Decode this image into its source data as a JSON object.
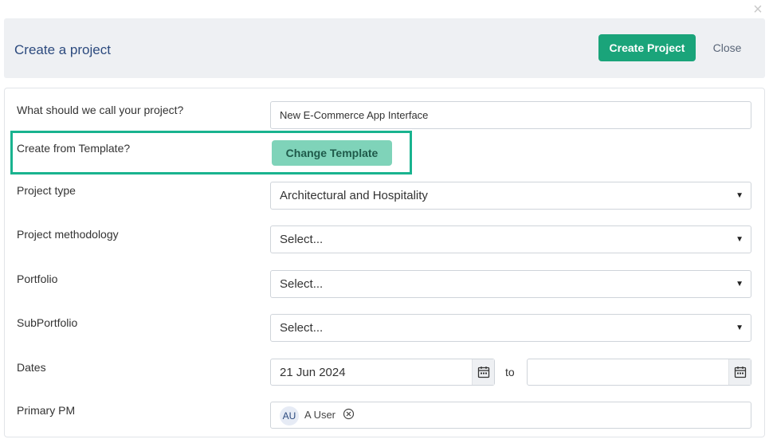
{
  "dialog": {
    "close_glyph": "×"
  },
  "header": {
    "title": "Create a project",
    "create_label": "Create Project",
    "close_label": "Close"
  },
  "form": {
    "name": {
      "label": "What should we call your project?",
      "value": "New E-Commerce App Interface"
    },
    "template": {
      "label": "Create from Template?",
      "button_label": "Change Template"
    },
    "project_type": {
      "label": "Project type",
      "value": "Architectural and Hospitality"
    },
    "methodology": {
      "label": "Project methodology",
      "value": "Select..."
    },
    "portfolio": {
      "label": "Portfolio",
      "value": "Select..."
    },
    "subportfolio": {
      "label": "SubPortfolio",
      "value": "Select..."
    },
    "dates": {
      "label": "Dates",
      "start": "21 Jun 2024",
      "to_label": "to",
      "end": ""
    },
    "primary_pm": {
      "label": "Primary PM",
      "avatar_initials": "AU",
      "user_name": "A User"
    }
  },
  "colors": {
    "accent": "#1aa47a",
    "highlight": "#19b38f",
    "title": "#2c4a7e"
  },
  "icons": [
    "close-icon",
    "chevron-down-icon",
    "calendar-icon",
    "remove-circle-icon"
  ]
}
